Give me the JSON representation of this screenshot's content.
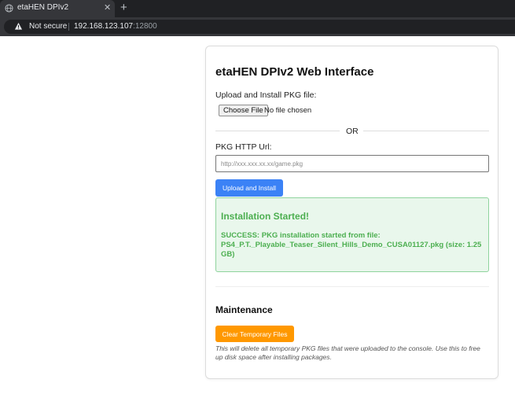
{
  "browser": {
    "tab_title": "etaHEN DPIv2",
    "close_glyph": "✕",
    "new_tab_glyph": "+",
    "security_label": "Not secure",
    "url_host": "192.168.123.107",
    "url_port": ":12800",
    "icons": [
      "globe-icon",
      "warning-icon"
    ]
  },
  "page": {
    "title": "etaHEN DPIv2 Web Interface",
    "upload_label": "Upload and Install PKG file:",
    "choose_file_label": "Choose File",
    "no_file_text": "No file chosen",
    "or_text": "OR",
    "url_label": "PKG HTTP Url:",
    "url_placeholder": "http://xxx.xxx.xx.xx/game.pkg",
    "url_value": "",
    "install_button": "Upload and Install",
    "success_title": "Installation Started!",
    "success_message": "SUCCESS: PKG installation started from file: PS4_P.T._Playable_Teaser_Silent_Hills_Demo_CUSA01127.pkg (size: 1.25 GB)",
    "maintenance_title": "Maintenance",
    "clear_button": "Clear Temporary Files",
    "maintenance_note": "This will delete all temporary PKG files that were uploaded to the console. Use this to free up disk space after installing packages."
  },
  "colors": {
    "primary_button": "#3b82f6",
    "warning_button": "#ff9800",
    "success_text": "#4caf50",
    "success_bg": "#e9f7ec"
  }
}
